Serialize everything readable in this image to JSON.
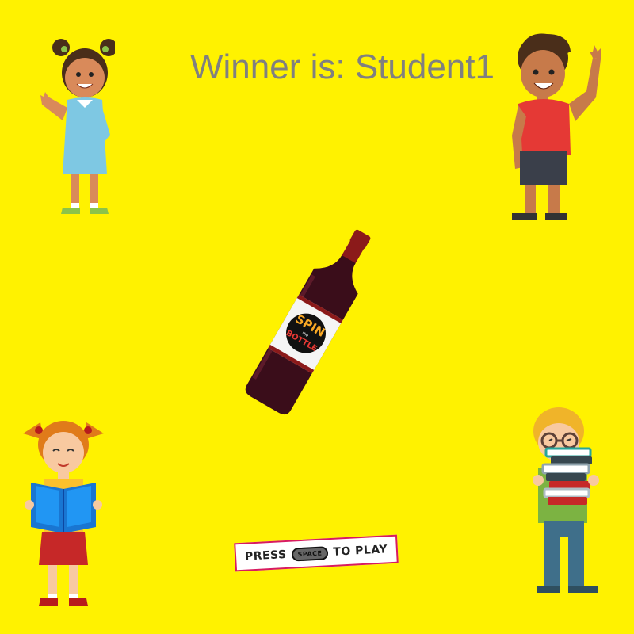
{
  "game": {
    "winner_text": "Winner is: Student1",
    "press_prefix": "PRESS",
    "space_key": "SPACE",
    "press_suffix": "TO PLAY",
    "bottle_label_top": "SPIN",
    "bottle_label_mid": "the",
    "bottle_label_bottom": "BOTTLE"
  },
  "characters": [
    {
      "name": "girl-blue-dress",
      "icon": "waving-girl-icon"
    },
    {
      "name": "boy-red-shirt",
      "icon": "waving-boy-icon"
    },
    {
      "name": "girl-reading",
      "icon": "reading-girl-icon"
    },
    {
      "name": "boy-with-books",
      "icon": "boy-books-icon"
    }
  ],
  "colors": {
    "background": "#FFF200",
    "winner_text": "#808080",
    "banner_border": "#D81B60"
  }
}
